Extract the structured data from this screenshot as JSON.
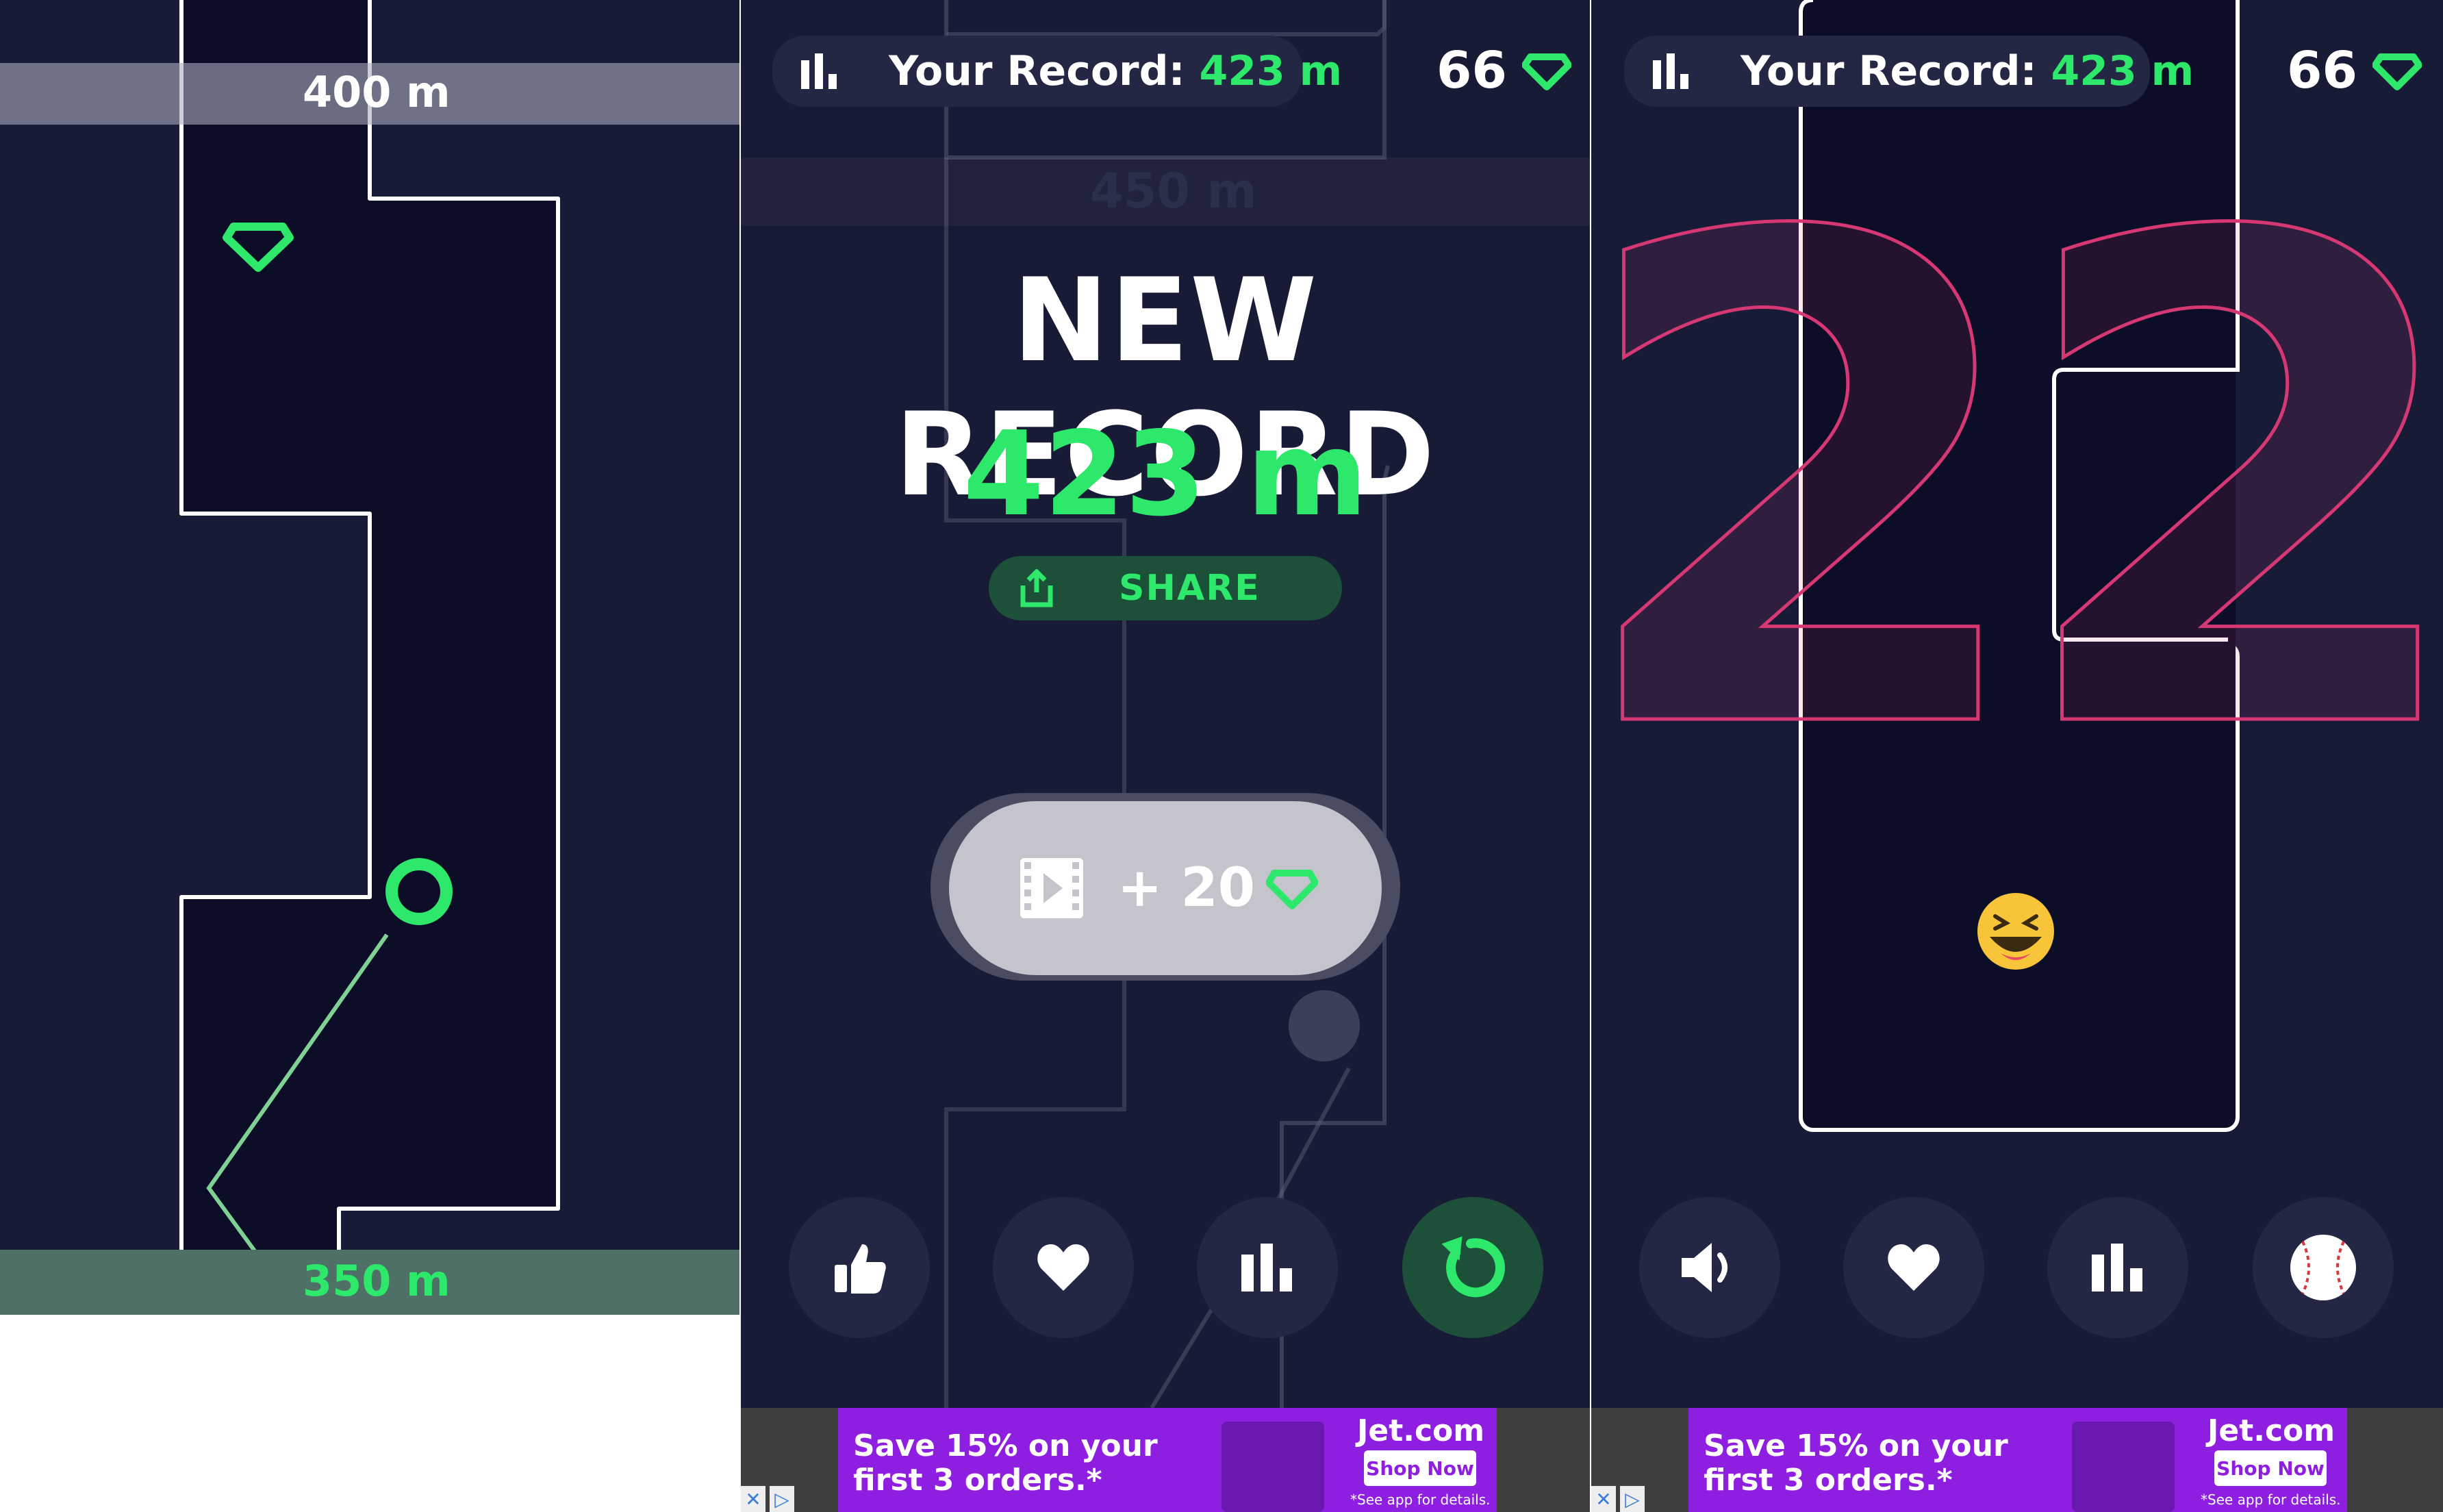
{
  "panel1": {
    "marker_top": "400 m",
    "marker_bottom": "350 m"
  },
  "panel2": {
    "record_chip": {
      "label": "Your Record: ",
      "value": "423 m"
    },
    "gem_count": "66",
    "ghost_marker": "450 m",
    "headline": "NEW RECORD",
    "distance": "423 m",
    "share_label": "SHARE",
    "reward_label": "+ 20",
    "buttons": [
      "like-icon",
      "heart-icon",
      "leaderboard-icon",
      "replay-icon"
    ]
  },
  "panel3": {
    "record_chip": {
      "label": "Your Record: ",
      "value": "423 m"
    },
    "gem_count": "66",
    "countdown": "22",
    "buttons": [
      "sound-icon",
      "heart-icon",
      "leaderboard-icon",
      "baseball-icon"
    ]
  },
  "ad": {
    "headline_line1": "Save 15% on your",
    "headline_line2": "first 3 orders.*",
    "brand": "Jet.com",
    "cta": "Shop Now",
    "note": "*See app for details."
  },
  "colors": {
    "background": "#181b36",
    "track": "#0c0d26",
    "accent": "#2de86a",
    "countdown": "#d63873",
    "ad": "#8e1fe0"
  }
}
